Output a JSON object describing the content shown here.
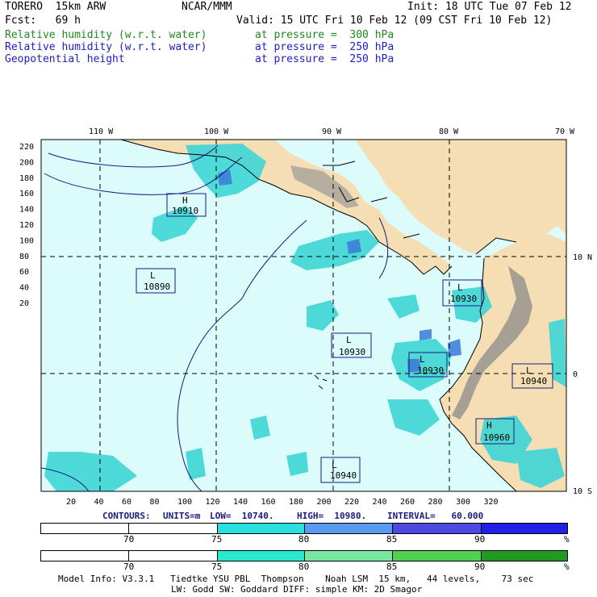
{
  "header": {
    "line1_left": "TORERO  15km ARW",
    "line1_mid": "NCAR/MMM",
    "line1_right": "Init: 18 UTC Tue 07 Feb 12",
    "line2_left": "Fcst:   69 h",
    "line2_right": "Valid: 15 UTC Fri 10 Feb 12 (09 CST Fri 10 Feb 12)",
    "fields": [
      {
        "name": "Relative humidity (w.r.t. water)",
        "level": "at pressure =  300 hPa",
        "color": "#1f8a1f"
      },
      {
        "name": "Relative humidity (w.r.t. water)",
        "level": "at pressure =  250 hPa",
        "color": "#2020c0"
      },
      {
        "name": "Geopotential height",
        "level": "at pressure =  250 hPa",
        "color": "#2020c0"
      }
    ]
  },
  "map": {
    "top_labels": [
      "110 W",
      "100 W",
      "90 W",
      "80 W",
      "70 W"
    ],
    "right_labels": [
      "10 N",
      "0",
      "10 S"
    ],
    "y_ticks": [
      "220",
      "200",
      "180",
      "160",
      "140",
      "120",
      "100",
      "80",
      "60",
      "40",
      "20"
    ],
    "x_ticks": [
      "20",
      "40",
      "60",
      "80",
      "100",
      "120",
      "140",
      "160",
      "180",
      "200",
      "220",
      "240",
      "260",
      "280",
      "300",
      "320"
    ],
    "height_centers": [
      {
        "type": "H",
        "value": "10910"
      },
      {
        "type": "L",
        "value": "10890"
      },
      {
        "type": "L",
        "value": "10930"
      },
      {
        "type": "L",
        "value": "10930"
      },
      {
        "type": "L",
        "value": "10930"
      },
      {
        "type": "L",
        "value": "10940"
      },
      {
        "type": "H",
        "value": "10960"
      },
      {
        "type": "L",
        "value": "10940"
      }
    ],
    "colors": {
      "ocean": "#dcfbfb",
      "land": "#f5deb3",
      "mountain": "#8a8a8a",
      "rh_cyan": "#3fd6d6",
      "rh_blue": "#3c78d8",
      "contour": "#1a1a80"
    }
  },
  "contours_line": {
    "label": "CONTOURS:",
    "units": "UNITS=m",
    "low": "LOW=  10740.",
    "high": "HIGH=  10980.",
    "interval": "INTERVAL=   60.000"
  },
  "colorbar_blue": {
    "ticks": [
      "70",
      "75",
      "80",
      "85",
      "90"
    ],
    "unit": "%",
    "colors": [
      "#ffffff",
      "#ffffff",
      "#28e0e0",
      "#5a9af0",
      "#4a4ae0",
      "#2020e8"
    ]
  },
  "colorbar_green": {
    "ticks": [
      "70",
      "75",
      "80",
      "85",
      "90"
    ],
    "unit": "%",
    "colors": [
      "#ffffff",
      "#ffffff",
      "#28e8d0",
      "#78e8a0",
      "#50d050",
      "#209a20"
    ]
  },
  "footer": {
    "line1": "Model Info: V3.3.1   Tiedtke YSU PBL  Thompson    Noah LSM  15 km,   44 levels,    73 sec",
    "line2": "LW: Godd SW: Goddard DIFF: simple KM: 2D Smagor"
  }
}
